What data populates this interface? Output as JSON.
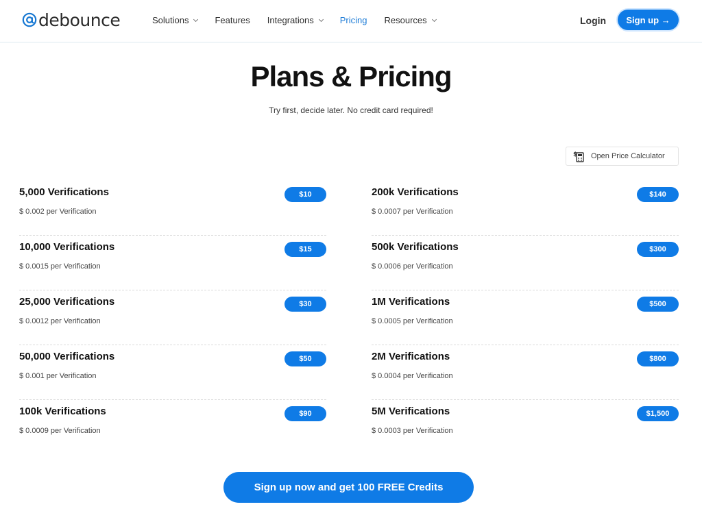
{
  "brand": {
    "name": "debounce",
    "logo_icon": "at-sign-icon"
  },
  "nav": {
    "items": [
      {
        "label": "Solutions",
        "dropdown": true,
        "active": false
      },
      {
        "label": "Features",
        "dropdown": false,
        "active": false
      },
      {
        "label": "Integrations",
        "dropdown": true,
        "active": false
      },
      {
        "label": "Pricing",
        "dropdown": false,
        "active": true
      },
      {
        "label": "Resources",
        "dropdown": true,
        "active": false
      }
    ],
    "login": "Login",
    "signup": "Sign up →"
  },
  "hero": {
    "title": "Plans & Pricing",
    "subtitle": "Try first, decide later. No credit card required!"
  },
  "calculator": {
    "label": "Open Price Calculator",
    "icon": "calculator-dollar-icon"
  },
  "plans": {
    "left": [
      {
        "name": "5,000 Verifications",
        "rate": "$ 0.002 per Verification",
        "price": "$10"
      },
      {
        "name": "10,000 Verifications",
        "rate": "$ 0.0015 per Verification",
        "price": "$15"
      },
      {
        "name": "25,000 Verifications",
        "rate": "$ 0.0012 per Verification",
        "price": "$30"
      },
      {
        "name": "50,000 Verifications",
        "rate": "$ 0.001 per Verification",
        "price": "$50"
      },
      {
        "name": "100k Verifications",
        "rate": "$ 0.0009 per Verification",
        "price": "$90"
      }
    ],
    "right": [
      {
        "name": "200k Verifications",
        "rate": "$ 0.0007 per Verification",
        "price": "$140"
      },
      {
        "name": "500k Verifications",
        "rate": "$ 0.0006 per Verification",
        "price": "$300"
      },
      {
        "name": "1M Verifications",
        "rate": "$ 0.0005 per Verification",
        "price": "$500"
      },
      {
        "name": "2M Verifications",
        "rate": "$ 0.0004 per Verification",
        "price": "$800"
      },
      {
        "name": "5M Verifications",
        "rate": "$ 0.0003 per Verification",
        "price": "$1,500"
      }
    ]
  },
  "cta": {
    "label": "Sign up now and get 100 FREE Credits"
  },
  "colors": {
    "accent": "#0f7be6",
    "nav_active": "#1a7ad6",
    "text": "#111111"
  }
}
